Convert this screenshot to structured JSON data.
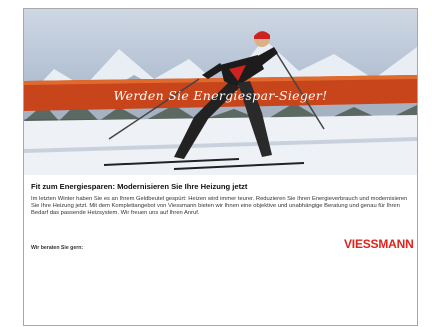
{
  "banner": {
    "slogan": "Werden Sie Energiespar-Sieger!"
  },
  "article": {
    "headline": "Fit zum Energiesparen: Modernisieren Sie Ihre Heizung jetzt",
    "body": "Im letzten Winter haben Sie es an Ihrem Geldbeutel gespürt: Heizen wird immer teurer. Reduzieren Sie Ihren Energieverbrauch und modernisieren Sie Ihre Heizung jetzt. Mit dem Komplettangebot von Viessmann bieten wir Ihnen eine objektive und unabhängige Beratung und genau für Ihren Bedarf das passende Heizsystem. Wir freuen uns auf Ihren Anruf.",
    "contact_label": "Wir beraten Sie gern:"
  },
  "brand": {
    "logo_text": "VIESSMANN",
    "color": "#e2231a"
  }
}
